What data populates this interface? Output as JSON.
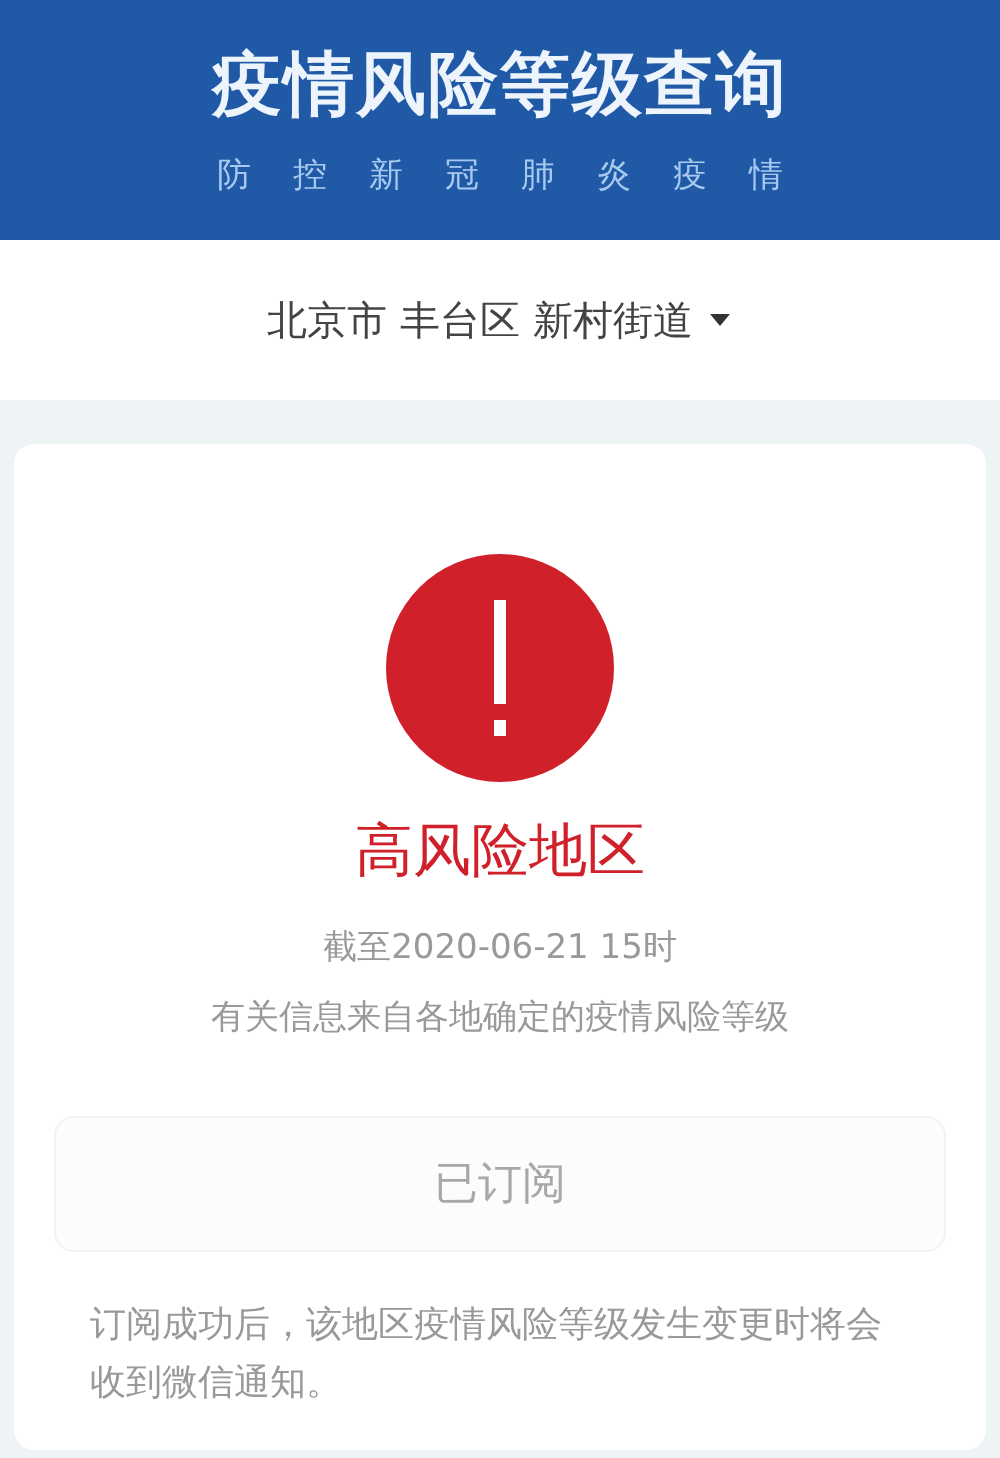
{
  "header": {
    "title": "疫情风险等级查询",
    "subtitle": [
      "防",
      "控",
      "新",
      "冠",
      "肺",
      "炎",
      "疫",
      "情"
    ]
  },
  "location": {
    "parts": [
      "北京市",
      "丰台区",
      "新村街道"
    ]
  },
  "result": {
    "kind": "high",
    "level_label": "高风险地区",
    "updated": "截至2020-06-21 15时",
    "source_note": "有关信息来自各地确定的疫情风险等级"
  },
  "subscribe_button": {
    "label": "已订阅",
    "disabled": true
  },
  "footer_note": "订阅成功后，该地区疫情风险等级发生变更时将会收到微信通知。"
}
